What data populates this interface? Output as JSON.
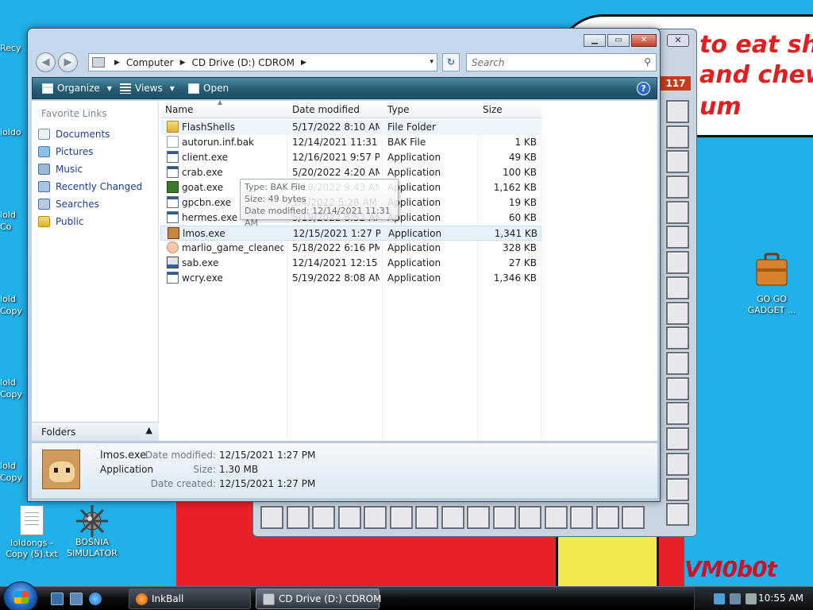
{
  "desktop": {
    "banner_lines": [
      "to eat shit",
      "and chew",
      "um"
    ],
    "signature": "VM0b0t",
    "left_labels": [
      "Recy",
      "loldo",
      "lold",
      "Co",
      "lold",
      "Copy",
      "lold",
      "Copy",
      "lold",
      "Copy"
    ],
    "icons": [
      {
        "label": "loldongs - Copy (5).txt",
        "icon": "text-file-icon"
      },
      {
        "label": "BOSNIA SIMULATOR",
        "icon": "spiked-mine-icon"
      },
      {
        "label": "GO GO GADGET ...",
        "icon": "briefcase-icon"
      }
    ]
  },
  "inkball": {
    "score": "117",
    "close": "✕"
  },
  "explorer": {
    "nav": {
      "back": "◀",
      "forward": "▶"
    },
    "address": {
      "crumbs": [
        "Computer",
        "CD Drive (D:) CDROM"
      ],
      "sep": "▶",
      "drop": "▾"
    },
    "refresh": "↻",
    "search_placeholder": "Search",
    "toolbar": {
      "organize": "Organize",
      "views": "Views",
      "open": "Open",
      "help": "?"
    },
    "favorites_title": "Favorite Links",
    "favorites": [
      "Documents",
      "Pictures",
      "Music",
      "Recently Changed",
      "Searches",
      "Public"
    ],
    "folders_label": "Folders",
    "columns": [
      "Name",
      "Date modified",
      "Type",
      "Size"
    ],
    "files": [
      {
        "name": "FlashShells",
        "date": "5/17/2022 8:10 AM",
        "type": "File Folder",
        "size": ""
      },
      {
        "name": "autorun.inf.bak",
        "date": "12/14/2021 11:31 ...",
        "type": "BAK File",
        "size": "1 KB"
      },
      {
        "name": "client.exe",
        "date": "12/16/2021 9:57 PM",
        "type": "Application",
        "size": "49 KB"
      },
      {
        "name": "crab.exe",
        "date": "5/20/2022 4:20 AM",
        "type": "Application",
        "size": "100 KB"
      },
      {
        "name": "goat.exe",
        "date": "5/18/2022 9:43 AM",
        "type": "Application",
        "size": "1,162 KB"
      },
      {
        "name": "gpcbn.exe",
        "date": "1/4/2022 5:28 AM",
        "type": "Application",
        "size": "19 KB"
      },
      {
        "name": "hermes.exe",
        "date": "5/19/2022 8:52 AM",
        "type": "Application",
        "size": "60 KB"
      },
      {
        "name": "lmos.exe",
        "date": "12/15/2021 1:27 PM",
        "type": "Application",
        "size": "1,341 KB"
      },
      {
        "name": "marlio_game_cleaned....",
        "date": "5/18/2022 6:16 PM",
        "type": "Application",
        "size": "328 KB"
      },
      {
        "name": "sab.exe",
        "date": "12/14/2021 12:15 ...",
        "type": "Application",
        "size": "27 KB"
      },
      {
        "name": "wcry.exe",
        "date": "5/19/2022 8:08 AM",
        "type": "Application",
        "size": "1,346 KB"
      }
    ],
    "tooltip": {
      "type": "Type: BAK File",
      "size": "Size: 49 bytes",
      "date": "Date modified: 12/14/2021 11:31 AM"
    },
    "details": {
      "name": "lmos.exe",
      "kind": "Application",
      "labels": [
        "Date modified:",
        "Size:",
        "Date created:"
      ],
      "values": [
        "12/15/2021 1:27 PM",
        "1.30 MB",
        "12/15/2021 1:27 PM"
      ]
    }
  },
  "taskbar": {
    "tasks": [
      "InkBall",
      "CD Drive (D:) CDROM"
    ],
    "clock": "10:55 AM"
  }
}
